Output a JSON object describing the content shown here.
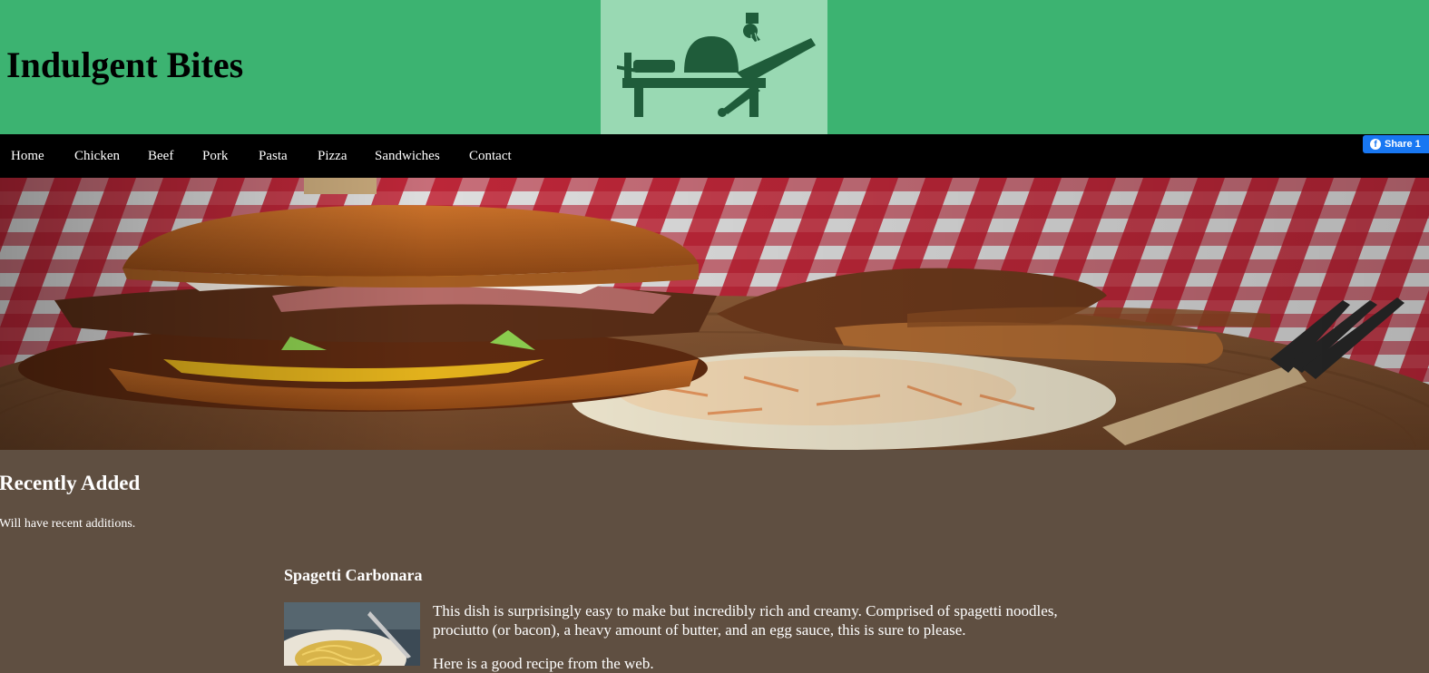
{
  "header": {
    "site_title": "Indulgent Bites",
    "logo_icon": "reclining-person-eating-icon"
  },
  "nav": {
    "items": [
      {
        "label": "Home"
      },
      {
        "label": "Chicken"
      },
      {
        "label": "Beef"
      },
      {
        "label": "Pork"
      },
      {
        "label": "Pasta"
      },
      {
        "label": "Pizza"
      },
      {
        "label": "Sandwiches"
      },
      {
        "label": "Contact"
      }
    ]
  },
  "share": {
    "label": "Share 1",
    "icon": "facebook-icon"
  },
  "hero": {
    "image": "burger-with-fries-and-coleslaw-photo"
  },
  "recent": {
    "heading": "Recently Added",
    "note": "Will have recent additions."
  },
  "recipe": {
    "title": "Spagetti Carbonara",
    "thumbnail": "spaghetti-carbonara-photo",
    "description": "This dish is surprisingly easy to make but incredibly rich and creamy. Comprised of spagetti noodles, prociutto (or bacon), a heavy amount of butter, and an egg sauce, this is sure to please.",
    "recipe_note": "Here is a good recipe from the web."
  },
  "colors": {
    "header_bg": "#3cb371",
    "logo_bg": "#99d9b3",
    "logo_fg": "#1f5c3a",
    "nav_bg": "#000000",
    "page_bg": "#5f4f41",
    "share_bg": "#1877f2"
  }
}
